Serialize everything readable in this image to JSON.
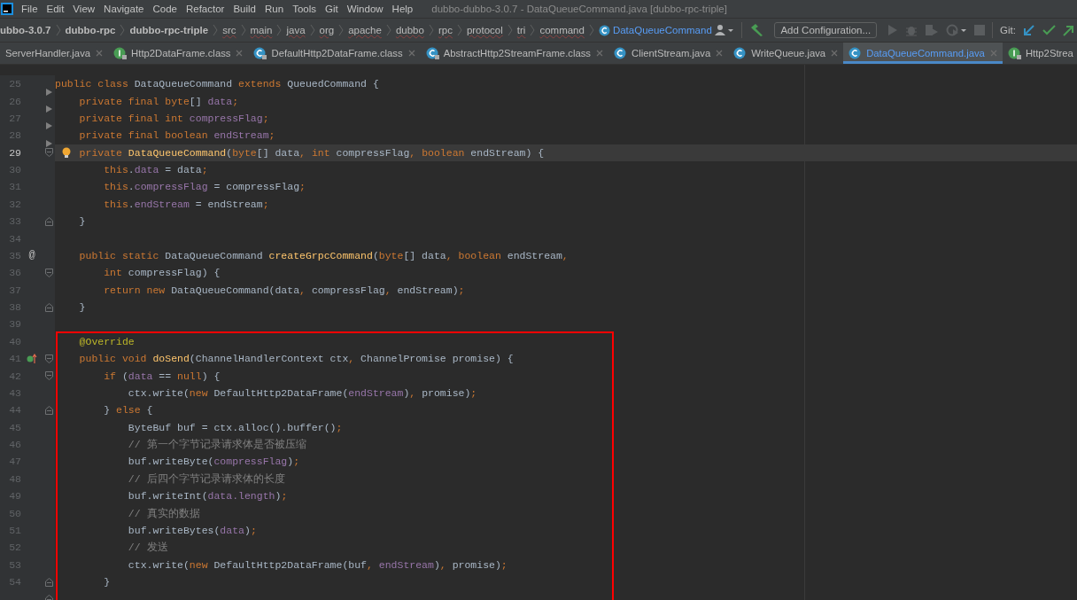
{
  "menu": {
    "items": [
      "File",
      "Edit",
      "View",
      "Navigate",
      "Code",
      "Refactor",
      "Build",
      "Run",
      "Tools",
      "Git",
      "Window",
      "Help"
    ],
    "title": "dubbo-dubbo-3.0.7 - DataQueueCommand.java [dubbo-rpc-triple]"
  },
  "breadcrumbs": [
    {
      "label": "ubbo-3.0.7",
      "kind": "module"
    },
    {
      "label": "dubbo-rpc",
      "kind": "module"
    },
    {
      "label": "dubbo-rpc-triple",
      "kind": "module"
    },
    {
      "label": "src",
      "kind": "folder"
    },
    {
      "label": "main",
      "kind": "folder"
    },
    {
      "label": "java",
      "kind": "folder"
    },
    {
      "label": "org",
      "kind": "folder"
    },
    {
      "label": "apache",
      "kind": "folder"
    },
    {
      "label": "dubbo",
      "kind": "folder"
    },
    {
      "label": "rpc",
      "kind": "folder"
    },
    {
      "label": "protocol",
      "kind": "folder"
    },
    {
      "label": "tri",
      "kind": "folder"
    },
    {
      "label": "command",
      "kind": "folder"
    },
    {
      "label": "DataQueueCommand",
      "kind": "class"
    }
  ],
  "toolbar": {
    "run_config": "Add Configuration...",
    "git_label": "Git:"
  },
  "tabs": [
    {
      "label": "ServerHandler.java",
      "kind": "plain",
      "selected": false
    },
    {
      "label": "Http2DataFrame.class",
      "kind": "library-interface",
      "selected": false
    },
    {
      "label": "DefaultHttp2DataFrame.class",
      "kind": "library-class",
      "selected": false
    },
    {
      "label": "AbstractHttp2StreamFrame.class",
      "kind": "library-class",
      "selected": false
    },
    {
      "label": "ClientStream.java",
      "kind": "class",
      "selected": false
    },
    {
      "label": "WriteQueue.java",
      "kind": "class",
      "selected": false
    },
    {
      "label": "DataQueueCommand.java",
      "kind": "class",
      "selected": true
    },
    {
      "label": "Http2Strea",
      "kind": "library-interface",
      "selected": false
    }
  ],
  "editor": {
    "lines": [
      {
        "number": "25",
        "current": false,
        "tokens": [
          {
            "kind": "kw",
            "text": "public class "
          },
          {
            "kind": "plain",
            "text": "DataQueueCommand "
          },
          {
            "kind": "kw",
            "text": "extends "
          },
          {
            "kind": "plain",
            "text": "QueuedCommand {"
          }
        ]
      },
      {
        "number": "26",
        "current": false,
        "tokens": [
          {
            "kind": "kw",
            "text": "    private final byte"
          },
          {
            "kind": "plain",
            "text": "[] "
          },
          {
            "kind": "field",
            "text": "data"
          },
          {
            "kind": "kw",
            "text": ";"
          }
        ]
      },
      {
        "number": "27",
        "current": false,
        "tokens": [
          {
            "kind": "kw",
            "text": "    private final int "
          },
          {
            "kind": "field",
            "text": "compressFlag"
          },
          {
            "kind": "kw",
            "text": ";"
          }
        ]
      },
      {
        "number": "28",
        "current": false,
        "tokens": [
          {
            "kind": "kw",
            "text": "    private final boolean "
          },
          {
            "kind": "field",
            "text": "endStream"
          },
          {
            "kind": "kw",
            "text": ";"
          }
        ]
      },
      {
        "number": "29",
        "current": true,
        "tokens": [
          {
            "kind": "kw",
            "text": "    private "
          },
          {
            "kind": "fn",
            "text": "DataQueueCommand"
          },
          {
            "kind": "plain",
            "text": "("
          },
          {
            "kind": "kw",
            "text": "byte"
          },
          {
            "kind": "plain",
            "text": "[] data"
          },
          {
            "kind": "kw",
            "text": ", int "
          },
          {
            "kind": "plain",
            "text": "compressFlag"
          },
          {
            "kind": "kw",
            "text": ", boolean "
          },
          {
            "kind": "plain",
            "text": "endStream) {"
          }
        ]
      },
      {
        "number": "30",
        "current": false,
        "tokens": [
          {
            "kind": "kw",
            "text": "        this"
          },
          {
            "kind": "plain",
            "text": "."
          },
          {
            "kind": "field",
            "text": "data"
          },
          {
            "kind": "plain",
            "text": " = data"
          },
          {
            "kind": "kw",
            "text": ";"
          }
        ]
      },
      {
        "number": "31",
        "current": false,
        "tokens": [
          {
            "kind": "kw",
            "text": "        this"
          },
          {
            "kind": "plain",
            "text": "."
          },
          {
            "kind": "field",
            "text": "compressFlag"
          },
          {
            "kind": "plain",
            "text": " = compressFlag"
          },
          {
            "kind": "kw",
            "text": ";"
          }
        ]
      },
      {
        "number": "32",
        "current": false,
        "tokens": [
          {
            "kind": "kw",
            "text": "        this"
          },
          {
            "kind": "plain",
            "text": "."
          },
          {
            "kind": "field",
            "text": "endStream"
          },
          {
            "kind": "plain",
            "text": " = endStream"
          },
          {
            "kind": "kw",
            "text": ";"
          }
        ]
      },
      {
        "number": "33",
        "current": false,
        "tokens": [
          {
            "kind": "plain",
            "text": "    }"
          }
        ]
      },
      {
        "number": "34",
        "current": false
      },
      {
        "number": "35",
        "current": false,
        "gutter_text": "@",
        "tokens": [
          {
            "kind": "kw",
            "text": "    public static "
          },
          {
            "kind": "plain",
            "text": "DataQueueCommand "
          },
          {
            "kind": "fn",
            "text": "createGrpcCommand"
          },
          {
            "kind": "plain",
            "text": "("
          },
          {
            "kind": "kw",
            "text": "byte"
          },
          {
            "kind": "plain",
            "text": "[] data"
          },
          {
            "kind": "kw",
            "text": ", boolean "
          },
          {
            "kind": "plain",
            "text": "endStream"
          },
          {
            "kind": "kw",
            "text": ","
          }
        ]
      },
      {
        "number": "36",
        "current": false,
        "tokens": [
          {
            "kind": "kw",
            "text": "        int "
          },
          {
            "kind": "plain",
            "text": "compressFlag) {"
          }
        ]
      },
      {
        "number": "37",
        "current": false,
        "tokens": [
          {
            "kind": "kw",
            "text": "        return new "
          },
          {
            "kind": "plain",
            "text": "DataQueueCommand(data"
          },
          {
            "kind": "kw",
            "text": ", "
          },
          {
            "kind": "plain",
            "text": "compressFlag"
          },
          {
            "kind": "kw",
            "text": ", "
          },
          {
            "kind": "plain",
            "text": "endStream)"
          },
          {
            "kind": "kw",
            "text": ";"
          }
        ]
      },
      {
        "number": "38",
        "current": false,
        "tokens": [
          {
            "kind": "plain",
            "text": "    }"
          }
        ]
      },
      {
        "number": "39",
        "current": false
      }
    ],
    "boxed_lines": [
      {
        "number": "40",
        "current": false,
        "tokens": [
          {
            "kind": "annotation",
            "text": "    @Override"
          }
        ]
      },
      {
        "number": "41",
        "current": false,
        "tokens": [
          {
            "kind": "kw",
            "text": "    public void "
          },
          {
            "kind": "fn",
            "text": "doSend"
          },
          {
            "kind": "plain",
            "text": "(ChannelHandlerContext ctx"
          },
          {
            "kind": "kw",
            "text": ", "
          },
          {
            "kind": "plain",
            "text": "ChannelPromise promise) {"
          }
        ]
      },
      {
        "number": "42",
        "current": false,
        "tokens": [
          {
            "kind": "kw",
            "text": "        if "
          },
          {
            "kind": "plain",
            "text": "("
          },
          {
            "kind": "field",
            "text": "data"
          },
          {
            "kind": "plain",
            "text": " == "
          },
          {
            "kind": "kw",
            "text": "null"
          },
          {
            "kind": "plain",
            "text": ") {"
          }
        ]
      },
      {
        "number": "43",
        "current": false,
        "tokens": [
          {
            "kind": "plain",
            "text": "            ctx.write("
          },
          {
            "kind": "kw",
            "text": "new "
          },
          {
            "kind": "plain",
            "text": "DefaultHttp2DataFrame("
          },
          {
            "kind": "field",
            "text": "endStream"
          },
          {
            "kind": "plain",
            "text": ")"
          },
          {
            "kind": "kw",
            "text": ", "
          },
          {
            "kind": "plain",
            "text": "promise)"
          },
          {
            "kind": "kw",
            "text": ";"
          }
        ]
      },
      {
        "number": "44",
        "current": false,
        "tokens": [
          {
            "kind": "plain",
            "text": "        } "
          },
          {
            "kind": "kw",
            "text": "else "
          },
          {
            "kind": "plain",
            "text": "{"
          }
        ]
      },
      {
        "number": "45",
        "current": false,
        "tokens": [
          {
            "kind": "plain",
            "text": "            ByteBuf buf = ctx.alloc().buffer()"
          },
          {
            "kind": "kw",
            "text": ";"
          }
        ]
      },
      {
        "number": "46",
        "current": false,
        "tokens": [
          {
            "kind": "comment",
            "text": "            // 第一个字节记录请求体是否被压缩"
          }
        ]
      },
      {
        "number": "47",
        "current": false,
        "tokens": [
          {
            "kind": "plain",
            "text": "            buf.writeByte("
          },
          {
            "kind": "field",
            "text": "compressFlag"
          },
          {
            "kind": "plain",
            "text": ")"
          },
          {
            "kind": "kw",
            "text": ";"
          }
        ]
      },
      {
        "number": "48",
        "current": false,
        "tokens": [
          {
            "kind": "comment",
            "text": "            // 后四个字节记录请求体的长度"
          }
        ]
      },
      {
        "number": "49",
        "current": false,
        "tokens": [
          {
            "kind": "plain",
            "text": "            buf.writeInt("
          },
          {
            "kind": "field",
            "text": "data.length"
          },
          {
            "kind": "plain",
            "text": ")"
          },
          {
            "kind": "kw",
            "text": ";"
          }
        ]
      },
      {
        "number": "50",
        "current": false,
        "tokens": [
          {
            "kind": "comment",
            "text": "            // 真实的数据"
          }
        ]
      },
      {
        "number": "51",
        "current": false,
        "tokens": [
          {
            "kind": "plain",
            "text": "            buf.writeBytes("
          },
          {
            "kind": "field",
            "text": "data"
          },
          {
            "kind": "plain",
            "text": ")"
          },
          {
            "kind": "kw",
            "text": ";"
          }
        ]
      },
      {
        "number": "52",
        "current": false,
        "tokens": [
          {
            "kind": "comment",
            "text": "            // 发送"
          }
        ]
      },
      {
        "number": "53",
        "current": false,
        "tokens": [
          {
            "kind": "plain",
            "text": "            ctx.write("
          },
          {
            "kind": "kw",
            "text": "new "
          },
          {
            "kind": "plain",
            "text": "DefaultHttp2DataFrame(buf"
          },
          {
            "kind": "kw",
            "text": ", "
          },
          {
            "kind": "field",
            "text": "endStream"
          },
          {
            "kind": "plain",
            "text": ")"
          },
          {
            "kind": "kw",
            "text": ", "
          },
          {
            "kind": "plain",
            "text": "promise)"
          },
          {
            "kind": "kw",
            "text": ";"
          }
        ]
      },
      {
        "number": "54",
        "current": false,
        "tokens": [
          {
            "kind": "plain",
            "text": "        }"
          }
        ]
      }
    ]
  }
}
